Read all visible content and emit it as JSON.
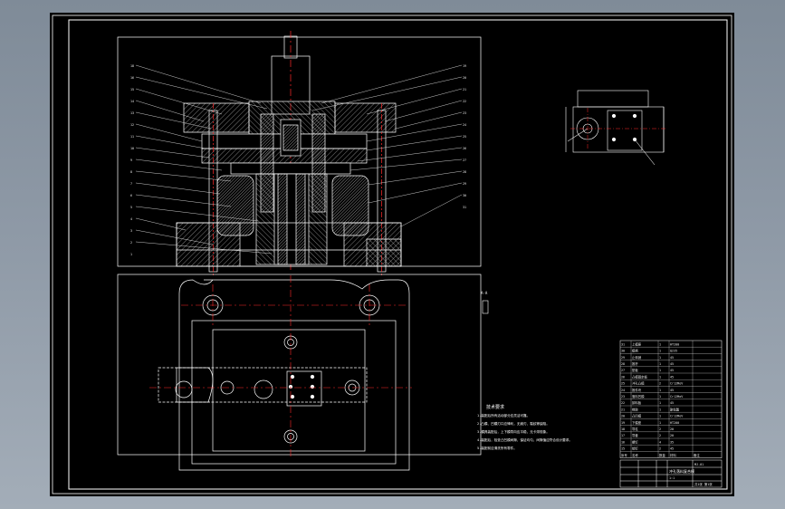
{
  "drawing": {
    "tech_req_title": "技术要求",
    "tech_notes": [
      "1.装配后所有活动部分应灵活可靠。",
      "2.凸模、凹模刃口应锋利，无崩刃、裂纹等缺陷。",
      "3.模具装配后，上下模导向应平稳，无卡滞现象。",
      "4.装配后，检查凸凹模间隙，保证均匀，间隙值应符合设计要求。",
      "5.装配前应清洗所有零件。"
    ],
    "view_label": "A-A",
    "part_numbers_left": [
      "18",
      "16",
      "15",
      "14",
      "13",
      "12",
      "11",
      "10",
      "9",
      "8",
      "7",
      "6",
      "5",
      "4",
      "3",
      "2",
      "1"
    ],
    "part_numbers_right": [
      "19",
      "20",
      "21",
      "22",
      "23",
      "24",
      "25",
      "26",
      "27",
      "28",
      "29",
      "30",
      "31"
    ],
    "title_block": {
      "name": "冲孔落料复合模",
      "drawing_no": "MJ-01",
      "scale": "1:1",
      "sheet": "共1张 第1张"
    },
    "bom_header": [
      "序号",
      "名称",
      "数量",
      "材料",
      "备注"
    ],
    "bom_rows": [
      [
        "31",
        "上模座",
        "1",
        "HT200",
        ""
      ],
      [
        "30",
        "模柄",
        "1",
        "Q235",
        ""
      ],
      [
        "29",
        "止转销",
        "1",
        "45",
        ""
      ],
      [
        "28",
        "推杆",
        "1",
        "45",
        ""
      ],
      [
        "27",
        "垫板",
        "1",
        "45",
        ""
      ],
      [
        "26",
        "凸模固定板",
        "1",
        "45",
        ""
      ],
      [
        "25",
        "冲孔凸模",
        "2",
        "Cr12MoV",
        ""
      ],
      [
        "24",
        "推件块",
        "1",
        "45",
        ""
      ],
      [
        "23",
        "落料凹模",
        "1",
        "Cr12MoV",
        ""
      ],
      [
        "22",
        "卸料板",
        "1",
        "45",
        ""
      ],
      [
        "21",
        "橡胶",
        "1",
        "聚氨酯",
        ""
      ],
      [
        "20",
        "凸凹模",
        "1",
        "Cr12MoV",
        ""
      ],
      [
        "19",
        "下模座",
        "1",
        "HT200",
        ""
      ],
      [
        "18",
        "导柱",
        "2",
        "20",
        ""
      ],
      [
        "17",
        "导套",
        "2",
        "20",
        ""
      ],
      [
        "16",
        "螺钉",
        "4",
        "35",
        ""
      ],
      [
        "15",
        "销钉",
        "2",
        "45",
        ""
      ]
    ]
  },
  "colors": {
    "background": "#000000",
    "frame": "#ffffff",
    "centerline": "#ff2a2a",
    "leader": "#e0e0e0"
  }
}
